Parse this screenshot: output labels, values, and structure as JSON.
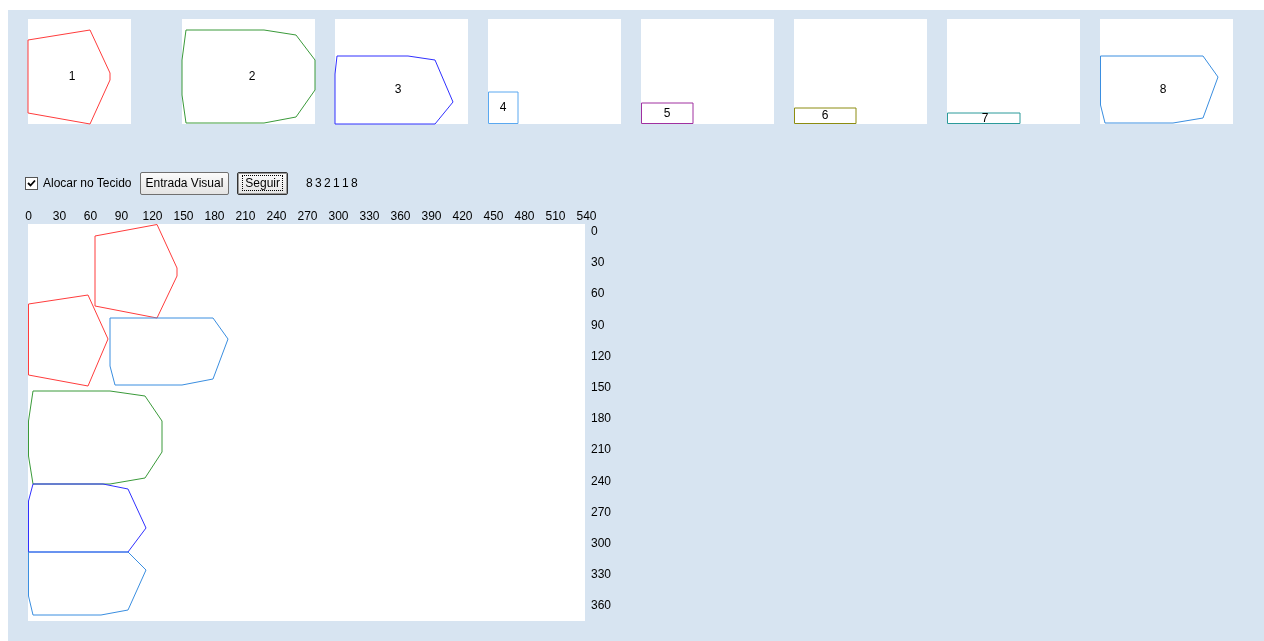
{
  "pieces": [
    {
      "label": "1",
      "color": "#ff3c3c"
    },
    {
      "label": "2",
      "color": "#3a9a3a"
    },
    {
      "label": "3",
      "color": "#3030ff"
    },
    {
      "label": "4",
      "color": "#5aa8f0"
    },
    {
      "label": "5",
      "color": "#a030a0"
    },
    {
      "label": "6",
      "color": "#8c8c10"
    },
    {
      "label": "7",
      "color": "#2a9a9a"
    },
    {
      "label": "8",
      "color": "#3a8ee0"
    }
  ],
  "allocate": {
    "label": "Alocar no Tecido",
    "checked": true
  },
  "buttons": [
    {
      "label": "Entrada Visual",
      "focused": false
    },
    {
      "label": "Seguir",
      "focused": true
    }
  ],
  "sequence": "8 3 2 1 1 8",
  "x_ruler": [
    "0",
    "30",
    "60",
    "90",
    "120",
    "150",
    "180",
    "210",
    "240",
    "270",
    "300",
    "330",
    "360",
    "390",
    "420",
    "450",
    "480",
    "510",
    "540"
  ],
  "y_ruler": [
    "0",
    "30",
    "60",
    "90",
    "120",
    "150",
    "180",
    "210",
    "240",
    "270",
    "300",
    "330",
    "360"
  ],
  "placed": [
    {
      "color": "#ff3c3c"
    },
    {
      "color": "#ff3c3c"
    },
    {
      "color": "#3a8ee0"
    },
    {
      "color": "#3a9a3a"
    },
    {
      "color": "#3030ff"
    },
    {
      "color": "#3a8ee0"
    }
  ]
}
